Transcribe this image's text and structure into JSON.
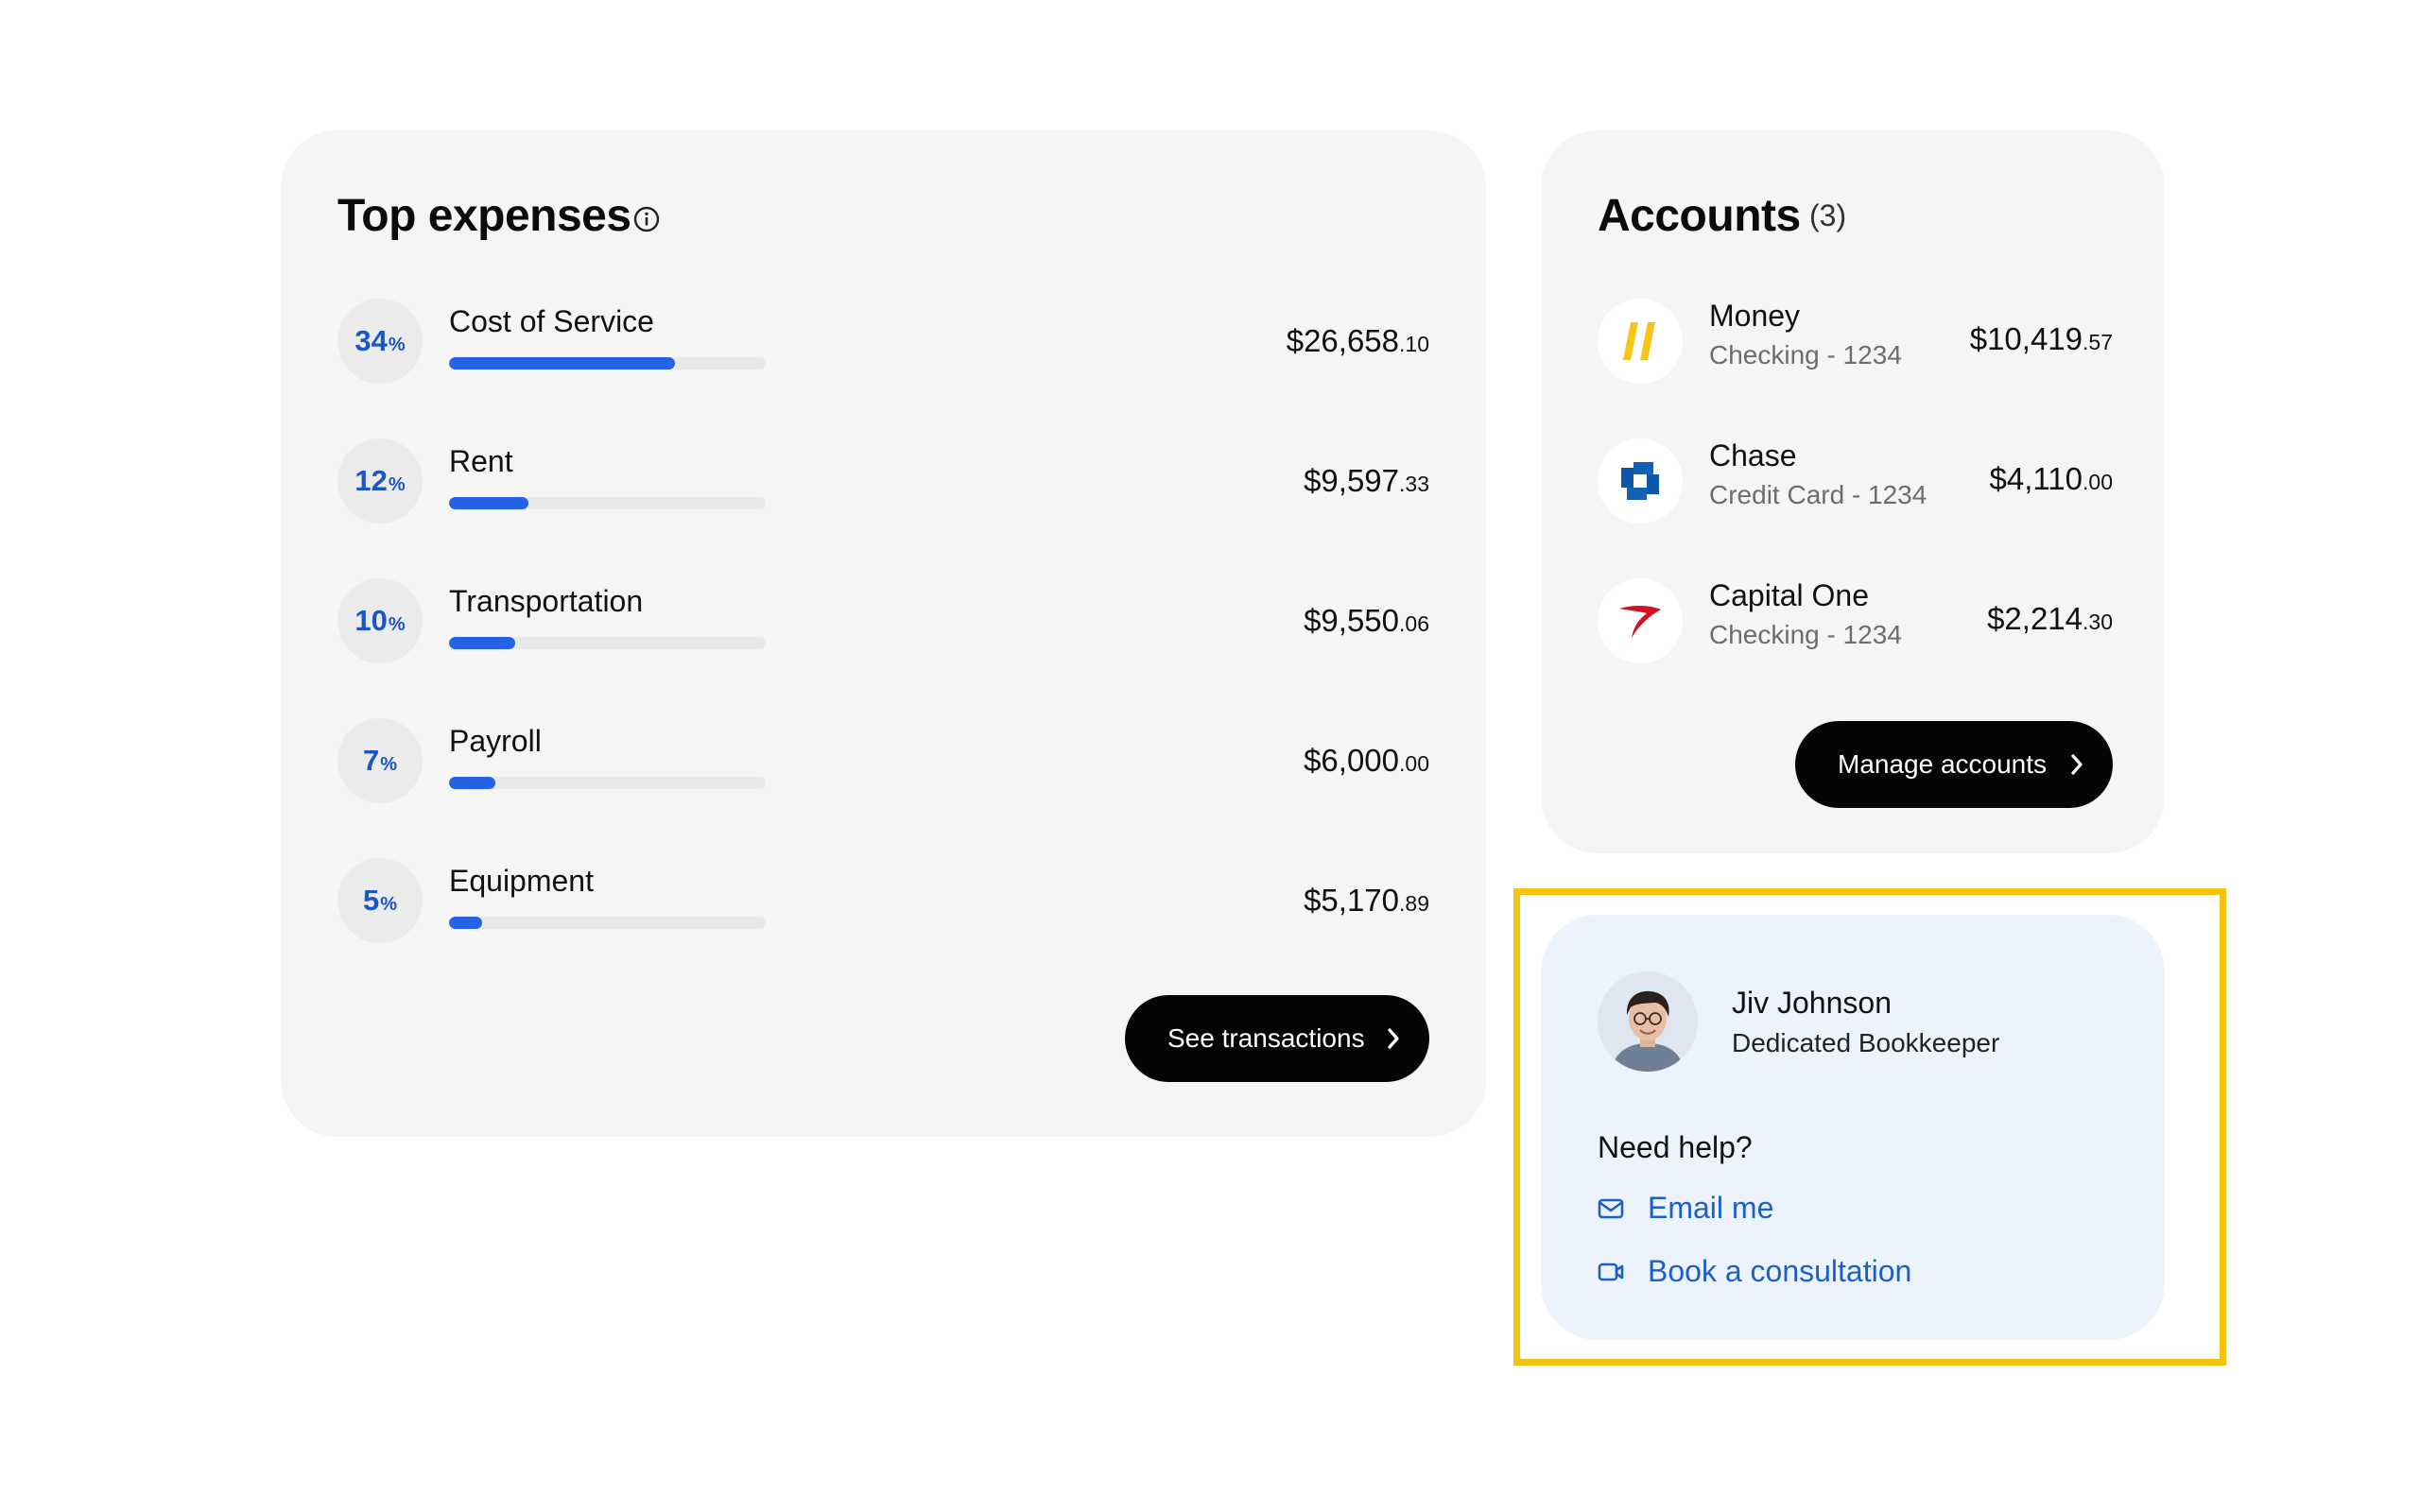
{
  "expenses": {
    "title": "Top expenses",
    "items": [
      {
        "pct": "34",
        "pct_sym": "%",
        "name": "Cost of Service",
        "amount_main": "$26,658",
        "amount_cents": ".10",
        "share": 0.34
      },
      {
        "pct": "12",
        "pct_sym": "%",
        "name": "Rent",
        "amount_main": "$9,597",
        "amount_cents": ".33",
        "share": 0.12
      },
      {
        "pct": "10",
        "pct_sym": "%",
        "name": "Transportation",
        "amount_main": "$9,550",
        "amount_cents": ".06",
        "share": 0.1
      },
      {
        "pct": "7",
        "pct_sym": "%",
        "name": "Payroll",
        "amount_main": "$6,000",
        "amount_cents": ".00",
        "share": 0.07
      },
      {
        "pct": "5",
        "pct_sym": "%",
        "name": "Equipment",
        "amount_main": "$5,170",
        "amount_cents": ".89",
        "share": 0.05
      }
    ],
    "button_label": "See transactions"
  },
  "accounts": {
    "title": "Accounts",
    "count": "(3)",
    "items": [
      {
        "name": "Money",
        "subtitle": "Checking - 1234",
        "amount_main": "$10,419",
        "amount_cents": ".57",
        "logo": "money-logo"
      },
      {
        "name": "Chase",
        "subtitle": "Credit Card - 1234",
        "amount_main": "$4,110",
        "amount_cents": ".00",
        "logo": "chase-logo"
      },
      {
        "name": "Capital One",
        "subtitle": "Checking - 1234",
        "amount_main": "$2,214",
        "amount_cents": ".30",
        "logo": "capital-one-logo"
      }
    ],
    "button_label": "Manage accounts"
  },
  "bookkeeper": {
    "name": "Jiv Johnson",
    "role": "Dedicated Bookkeeper",
    "help_heading": "Need help?",
    "email_label": "Email me",
    "consult_label": "Book a consultation"
  },
  "colors": {
    "accent_blue": "#2563e6",
    "link_blue": "#1d5fc9",
    "highlight_yellow": "#f2c40f",
    "button_black": "#050505"
  }
}
